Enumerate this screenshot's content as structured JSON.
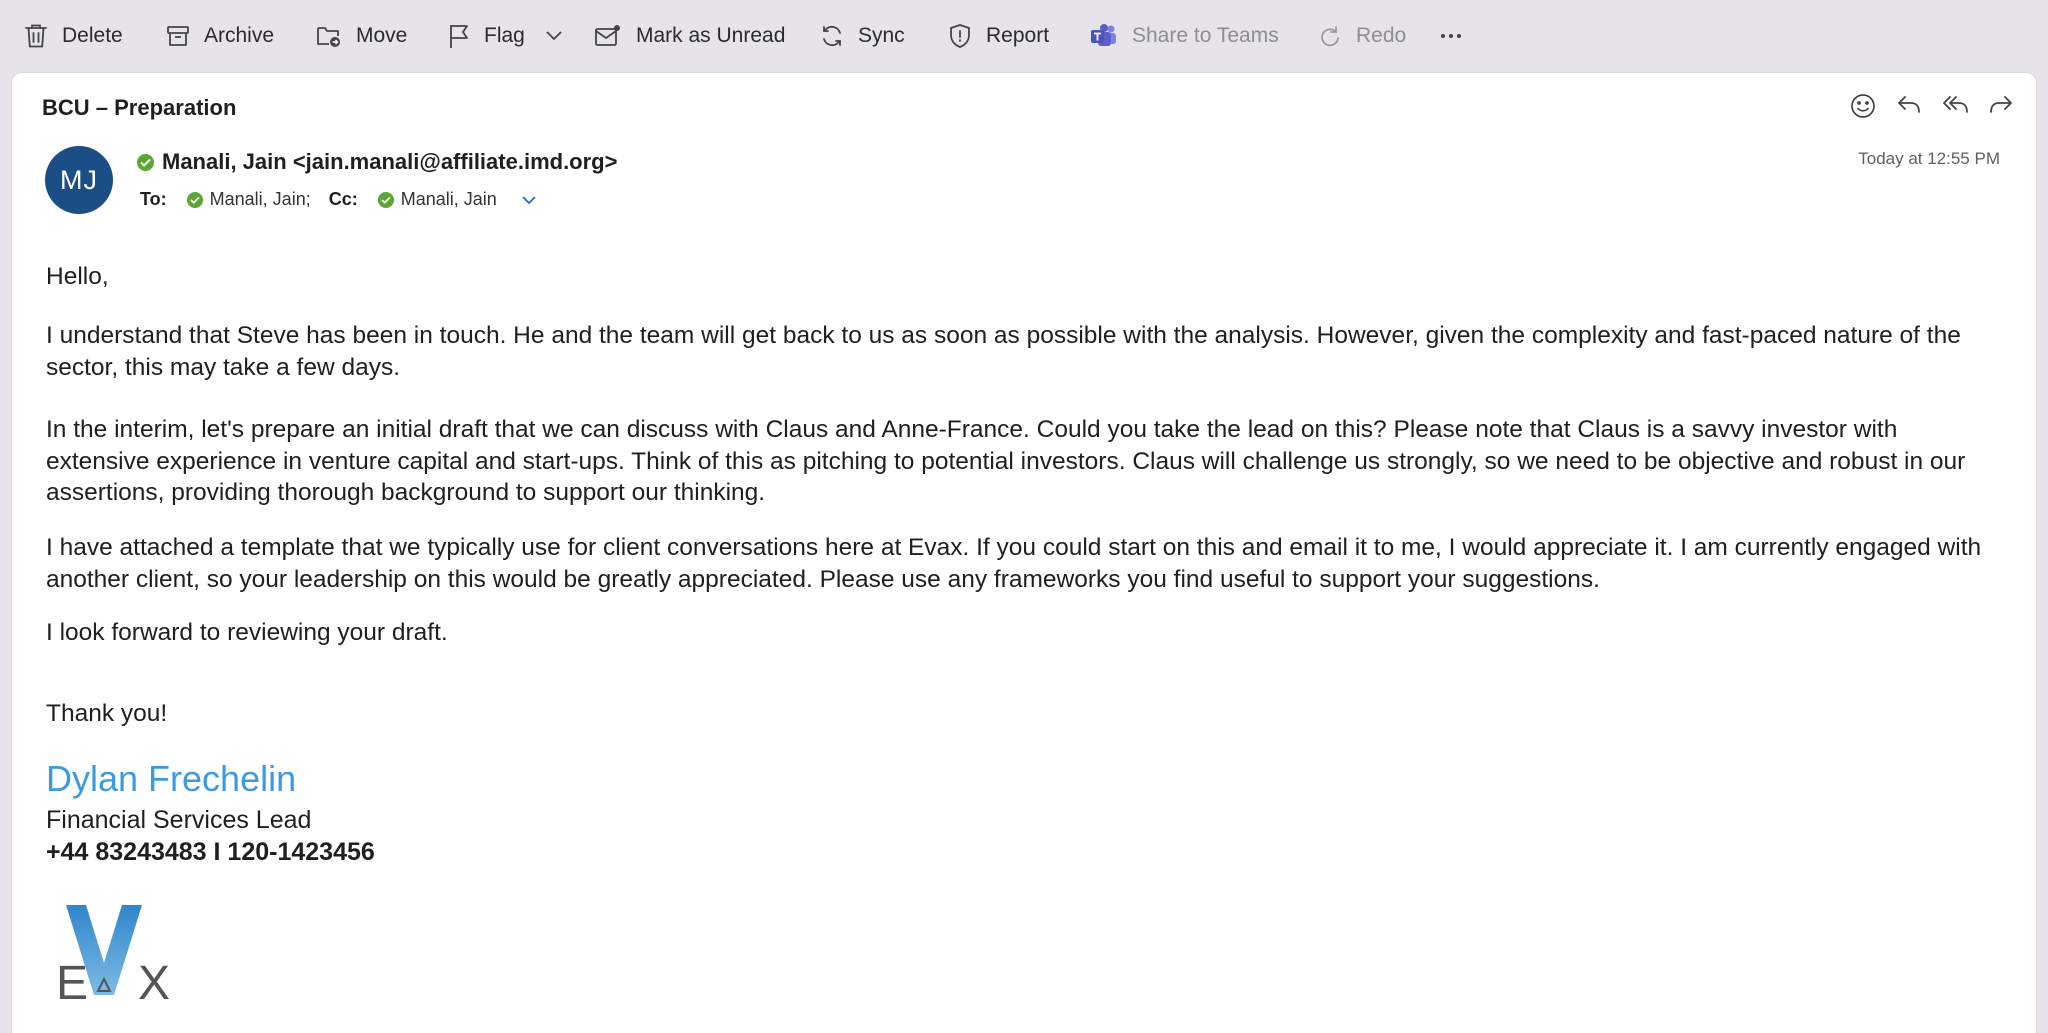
{
  "toolbar": {
    "delete": "Delete",
    "archive": "Archive",
    "move": "Move",
    "flag": "Flag",
    "mark_unread": "Mark as Unread",
    "sync": "Sync",
    "report": "Report",
    "share_teams": "Share to Teams",
    "redo": "Redo"
  },
  "message": {
    "subject": "BCU – Preparation",
    "avatar_initials": "MJ",
    "sender": "Manali, Jain <jain.manali@affiliate.imd.org>",
    "to_label": "To:",
    "to_name": "Manali, Jain;",
    "cc_label": "Cc:",
    "cc_name": "Manali, Jain",
    "timestamp": "Today at 12:55 PM"
  },
  "body": {
    "greeting": "Hello,",
    "p1": "I understand that Steve has been in touch. He and the team will get back to us as soon as possible with the analysis. However, given the complexity and fast-paced nature of the sector, this may take a few days.",
    "p2": "In the interim, let's prepare an initial draft that we can discuss with Claus and Anne-France. Could you take the lead on this? Please note that Claus is a savvy investor with extensive experience in venture capital and start-ups. Think of this as pitching to potential investors. Claus will challenge us strongly, so we need to be objective and robust in our assertions, providing thorough background to support our thinking.",
    "p3": "I have attached a template that we typically use for client conversations here at Evax. If you could start on this and email it to me, I would appreciate it. I am currently engaged with another client, so your leadership on this would be greatly appreciated. Please use any frameworks you find useful to support your suggestions.",
    "p4": "I look forward to reviewing your draft.",
    "closing": "Thank you!"
  },
  "signature": {
    "name": "Dylan Frechelin",
    "title": "Financial Services Lead",
    "phone": "+44 83243483 I 120-1423456",
    "logo_text": "EVAX"
  },
  "colors": {
    "accent": "#3c9be0",
    "avatar": "#1c4e86",
    "presence": "#5aa832",
    "teams": "#5b5fc7"
  }
}
